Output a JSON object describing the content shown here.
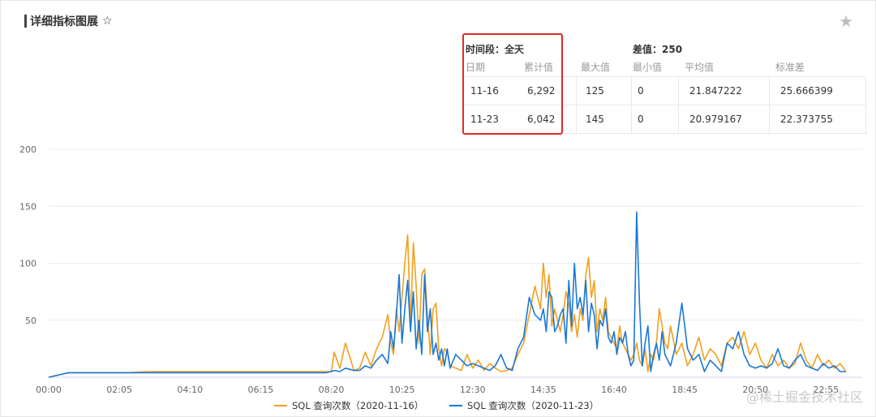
{
  "title": "详细指标图展",
  "title_star": "☆",
  "fav_icon": "star-icon",
  "stats": {
    "period_label": "时间段：全天",
    "diff_label": "差值：250",
    "columns": [
      "日期",
      "累计值",
      "最大值",
      "最小值",
      "平均值",
      "标准差"
    ],
    "rows": [
      [
        "11-16",
        "6,292",
        "125",
        "0",
        "21.847222",
        "25.666399"
      ],
      [
        "11-23",
        "6,042",
        "145",
        "0",
        "20.979167",
        "22.373755"
      ]
    ]
  },
  "watermark": "@稀土掘金技术社区",
  "chart_data": {
    "type": "line",
    "x_tick_labels": [
      "00:00",
      "02:05",
      "04:10",
      "06:15",
      "08:20",
      "10:25",
      "12:30",
      "14:35",
      "16:40",
      "18:45",
      "20:50",
      "22:55"
    ],
    "ylim": [
      0,
      200
    ],
    "y_ticks": [
      50,
      100,
      150,
      200
    ],
    "x": [
      "00:00",
      "00:35",
      "01:10",
      "01:45",
      "02:20",
      "02:55",
      "03:30",
      "04:05",
      "04:40",
      "05:15",
      "05:50",
      "06:25",
      "07:00",
      "07:35",
      "08:10",
      "08:20",
      "08:25",
      "08:35",
      "08:45",
      "09:00",
      "09:10",
      "09:20",
      "09:30",
      "09:40",
      "09:50",
      "10:00",
      "10:05",
      "10:10",
      "10:15",
      "10:20",
      "10:25",
      "10:30",
      "10:35",
      "10:40",
      "10:45",
      "10:50",
      "10:55",
      "11:00",
      "11:05",
      "11:10",
      "11:15",
      "11:20",
      "11:25",
      "11:30",
      "11:35",
      "11:40",
      "11:45",
      "11:50",
      "12:00",
      "12:10",
      "12:20",
      "12:30",
      "12:40",
      "12:50",
      "13:00",
      "13:10",
      "13:20",
      "13:30",
      "13:40",
      "13:50",
      "14:00",
      "14:10",
      "14:20",
      "14:30",
      "14:35",
      "14:40",
      "14:45",
      "14:50",
      "14:55",
      "15:00",
      "15:05",
      "15:10",
      "15:15",
      "15:20",
      "15:25",
      "15:30",
      "15:35",
      "15:40",
      "15:45",
      "15:50",
      "15:55",
      "16:00",
      "16:05",
      "16:10",
      "16:15",
      "16:20",
      "16:25",
      "16:30",
      "16:35",
      "16:40",
      "16:45",
      "16:50",
      "16:55",
      "17:00",
      "17:05",
      "17:10",
      "17:15",
      "17:20",
      "17:25",
      "17:30",
      "17:35",
      "17:40",
      "17:45",
      "17:50",
      "17:55",
      "18:00",
      "18:05",
      "18:10",
      "18:15",
      "18:20",
      "18:30",
      "18:40",
      "18:50",
      "19:00",
      "19:10",
      "19:20",
      "19:30",
      "19:40",
      "19:50",
      "20:00",
      "20:10",
      "20:20",
      "20:30",
      "20:40",
      "20:50",
      "21:00",
      "21:10",
      "21:20",
      "21:30",
      "21:40",
      "21:50",
      "22:00",
      "22:10",
      "22:20",
      "22:30",
      "22:40",
      "22:50",
      "23:00",
      "23:10",
      "23:20",
      "23:30",
      "23:40",
      "23:55"
    ],
    "series": [
      {
        "name": "SQL 查询次数（2020-11-16）",
        "color": "#f0a020",
        "values": [
          0,
          4,
          4,
          4,
          4,
          5,
          5,
          5,
          5,
          5,
          5,
          5,
          5,
          5,
          5,
          5,
          22,
          8,
          30,
          6,
          8,
          22,
          10,
          25,
          35,
          55,
          30,
          20,
          60,
          40,
          70,
          100,
          125,
          45,
          118,
          80,
          30,
          90,
          95,
          55,
          20,
          60,
          65,
          25,
          10,
          25,
          22,
          10,
          8,
          6,
          20,
          8,
          15,
          6,
          12,
          8,
          5,
          6,
          8,
          20,
          30,
          55,
          80,
          60,
          100,
          70,
          90,
          45,
          60,
          50,
          40,
          55,
          75,
          65,
          40,
          55,
          35,
          60,
          50,
          90,
          105,
          70,
          85,
          40,
          60,
          50,
          70,
          40,
          35,
          30,
          25,
          45,
          30,
          25,
          20,
          15,
          20,
          30,
          15,
          10,
          25,
          5,
          20,
          15,
          30,
          60,
          45,
          30,
          25,
          45,
          20,
          30,
          10,
          20,
          35,
          15,
          25,
          20,
          10,
          30,
          35,
          25,
          40,
          20,
          30,
          15,
          8,
          20,
          10,
          15,
          8,
          12,
          30,
          15,
          8,
          20,
          10,
          15,
          8,
          12,
          5
        ]
      },
      {
        "name": "SQL 查询次数（2020-11-23）",
        "color": "#1a78d6",
        "values": [
          0,
          4,
          4,
          4,
          4,
          4,
          4,
          4,
          4,
          4,
          4,
          4,
          4,
          4,
          4,
          5,
          6,
          5,
          8,
          6,
          6,
          10,
          8,
          15,
          20,
          12,
          40,
          25,
          55,
          90,
          30,
          60,
          85,
          40,
          75,
          25,
          50,
          20,
          90,
          40,
          60,
          20,
          30,
          15,
          25,
          10,
          25,
          8,
          20,
          15,
          10,
          12,
          10,
          8,
          6,
          10,
          20,
          8,
          6,
          25,
          35,
          70,
          55,
          50,
          60,
          40,
          75,
          70,
          40,
          45,
          55,
          60,
          30,
          85,
          45,
          100,
          60,
          70,
          55,
          85,
          40,
          65,
          55,
          25,
          50,
          45,
          60,
          35,
          30,
          40,
          20,
          35,
          30,
          40,
          20,
          10,
          15,
          145,
          65,
          10,
          30,
          45,
          5,
          20,
          30,
          15,
          40,
          20,
          15,
          10,
          30,
          65,
          25,
          15,
          20,
          5,
          15,
          10,
          5,
          30,
          25,
          40,
          20,
          10,
          8,
          10,
          8,
          12,
          25,
          10,
          8,
          15,
          20,
          10,
          8,
          6,
          12,
          8,
          10,
          5,
          5
        ]
      }
    ]
  }
}
